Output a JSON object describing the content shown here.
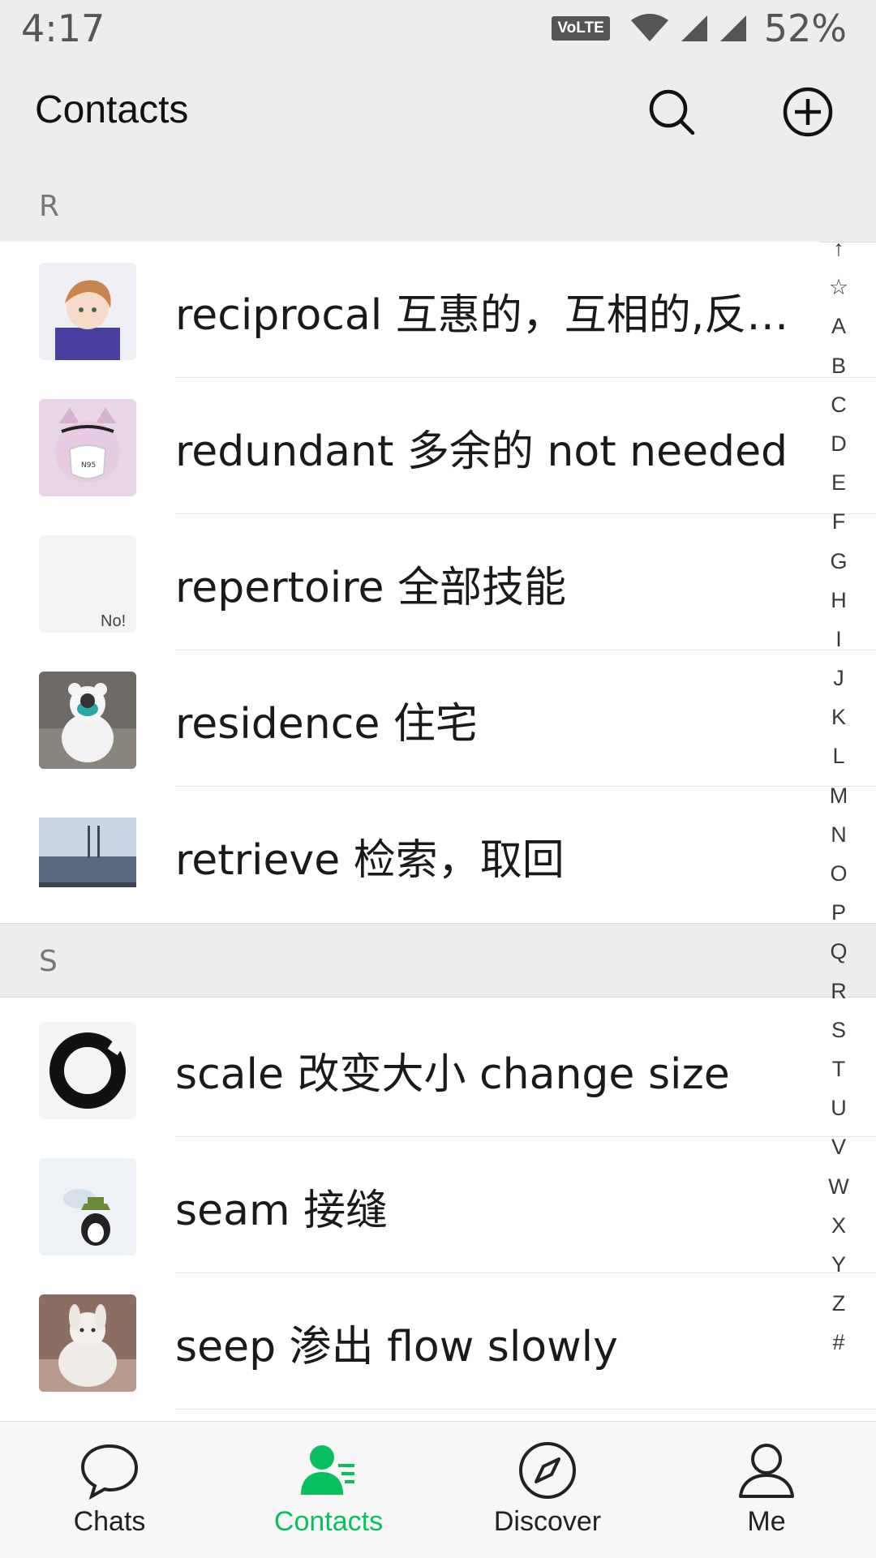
{
  "status_bar": {
    "time": "4:17",
    "volte": "VoLTE",
    "battery": "52%"
  },
  "header": {
    "title": "Contacts",
    "search_icon": "search-icon",
    "add_icon": "plus-circle-icon"
  },
  "sections": [
    {
      "letter": "R",
      "contacts": [
        {
          "name": "reciprocal 互惠的，互相的,反…",
          "avatar": "anime-boy"
        },
        {
          "name": "redundant 多余的  not needed",
          "avatar": "cat-with-mask"
        },
        {
          "name": "repertoire 全部技能",
          "avatar": "no-text"
        },
        {
          "name": "residence 住宅",
          "avatar": "figure-in-white-suit"
        },
        {
          "name": "retrieve 检索，取回",
          "avatar": "city-landscape"
        }
      ]
    },
    {
      "letter": "S",
      "contacts": [
        {
          "name": "scale 改变大小 change size",
          "avatar": "ink-circle"
        },
        {
          "name": "seam 接缝",
          "avatar": "cartoon-penguin"
        },
        {
          "name": "seep 渗出 flow slowly",
          "avatar": "plush-bunny"
        }
      ]
    }
  ],
  "index_bar": [
    "↑",
    "☆",
    "A",
    "B",
    "C",
    "D",
    "E",
    "F",
    "G",
    "H",
    "I",
    "J",
    "K",
    "L",
    "M",
    "N",
    "O",
    "P",
    "Q",
    "R",
    "S",
    "T",
    "U",
    "V",
    "W",
    "X",
    "Y",
    "Z",
    "#"
  ],
  "tabs": [
    {
      "label": "Chats",
      "icon": "chat-bubble-icon"
    },
    {
      "label": "Contacts",
      "icon": "contacts-icon",
      "active": true
    },
    {
      "label": "Discover",
      "icon": "compass-icon"
    },
    {
      "label": "Me",
      "icon": "person-icon"
    }
  ],
  "colors": {
    "accent": "#07c160",
    "header_bg": "#ededf0"
  }
}
